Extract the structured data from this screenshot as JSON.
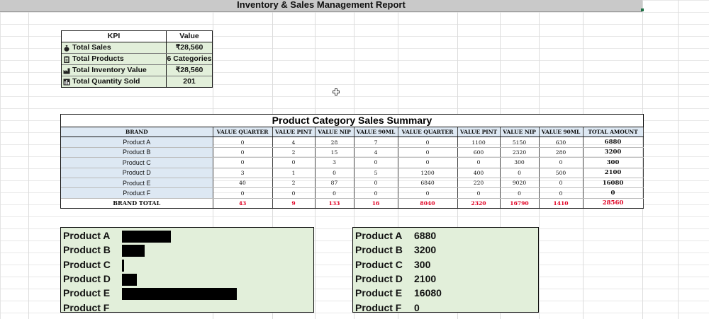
{
  "report": {
    "title": "Inventory & Sales Management Report"
  },
  "kpi": {
    "header": {
      "kpi": "KPI",
      "value": "Value"
    },
    "rows": [
      {
        "icon": "money-bag-icon",
        "label": "Total Sales",
        "value": "₹28,560"
      },
      {
        "icon": "clipboard-icon",
        "label": "Total Products",
        "value": "6 Categories"
      },
      {
        "icon": "factory-icon",
        "label": "Total Inventory Value",
        "value": "₹28,560"
      },
      {
        "icon": "bar-chart-icon",
        "label": "Total Quantity Sold",
        "value": "201"
      }
    ]
  },
  "summary": {
    "title": "Product Category Sales Summary",
    "columns": [
      "BRAND",
      "VALUE QUARTER",
      "VALUE PINT",
      "VALUE NIP",
      "VALUE 90ML",
      "VALUE QUARTER",
      "VALUE PINT",
      "VALUE NIP",
      "VALUE 90ML",
      "TOTAL AMOUNT"
    ],
    "rows": [
      [
        "Product A",
        "0",
        "4",
        "28",
        "7",
        "0",
        "1100",
        "5150",
        "630",
        "6880"
      ],
      [
        "Product B",
        "0",
        "2",
        "15",
        "4",
        "0",
        "600",
        "2320",
        "280",
        "3200"
      ],
      [
        "Product C",
        "0",
        "0",
        "3",
        "0",
        "0",
        "0",
        "300",
        "0",
        "300"
      ],
      [
        "Product D",
        "3",
        "1",
        "0",
        "5",
        "1200",
        "400",
        "0",
        "500",
        "2100"
      ],
      [
        "Product E",
        "40",
        "2",
        "87",
        "0",
        "6840",
        "220",
        "9020",
        "0",
        "16080"
      ],
      [
        "Product F",
        "0",
        "0",
        "0",
        "0",
        "0",
        "0",
        "0",
        "0",
        "0"
      ]
    ],
    "total": [
      "BRAND TOTAL",
      "43",
      "9",
      "133",
      "16",
      "8040",
      "2320",
      "16790",
      "1410",
      "28560"
    ]
  },
  "bar_panel": {
    "items": [
      {
        "label": "Product A",
        "value": 6880
      },
      {
        "label": "Product B",
        "value": 3200
      },
      {
        "label": "Product C",
        "value": 300
      },
      {
        "label": "Product D",
        "value": 2100
      },
      {
        "label": "Product E",
        "value": 16080
      },
      {
        "label": "Product F",
        "value": 0
      }
    ]
  },
  "value_panel": {
    "items": [
      {
        "label": "Product A",
        "value": "6880"
      },
      {
        "label": "Product B",
        "value": "3200"
      },
      {
        "label": "Product C",
        "value": "300"
      },
      {
        "label": "Product D",
        "value": "2100"
      },
      {
        "label": "Product E",
        "value": "16080"
      },
      {
        "label": "Product F",
        "value": "0"
      }
    ]
  },
  "colors": {
    "kpi_fill": "#e2efda",
    "header_fill": "#dde8f3",
    "total_text": "#e00022",
    "title_bar": "#c9c9c9"
  }
}
